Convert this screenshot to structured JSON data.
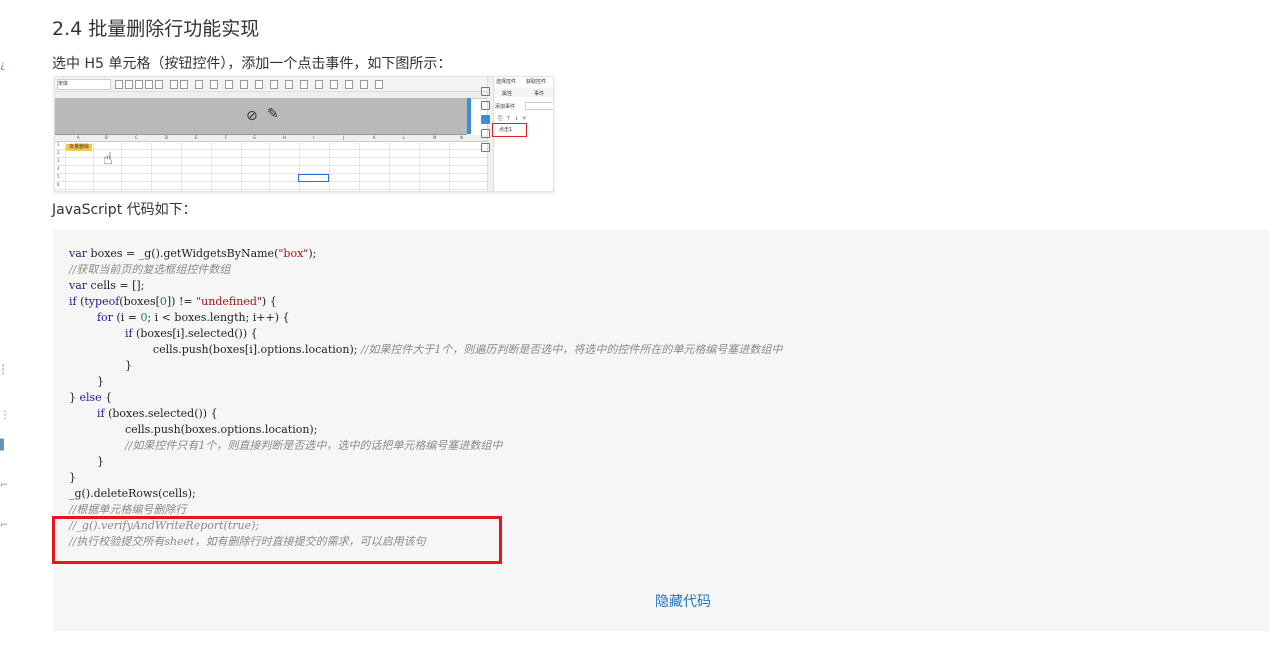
{
  "article": {
    "section_title": "2.4 批量删除行功能实现",
    "intro_text": "选中 H5 单元格（按钮控件），添加一个点击事件，如下图所示：",
    "js_caption": "JavaScript 代码如下："
  },
  "screenshot": {
    "toolbar_font": "宋体",
    "batch_button_label": "批量删除",
    "right_panel": {
      "tab1": "选择控件",
      "tab2": "获取控件",
      "subtab1": "属性",
      "subtab2": "事件",
      "add_event_label": "添加事件",
      "event_item": "点击1"
    },
    "icons": [
      "hidden-eye-icon",
      "pencil-icon",
      "hand-cursor-icon"
    ]
  },
  "code": {
    "lines": [
      "var boxes = _g().getWidgetsByName(\"box\");",
      "//获取当前页的复选框组控件数组",
      "var cells = [];",
      "if (typeof(boxes[0]) != \"undefined\") {",
      "        for (i = 0; i < boxes.length; i++) {",
      "                if (boxes[i].selected()) {",
      "                        cells.push(boxes[i].options.location); //如果控件大于1个，则遍历判断是否选中，将选中的控件所在的单元格编号塞进数组中",
      "                }",
      "        }",
      "} else {",
      "        if (boxes.selected()) {",
      "                cells.push(boxes.options.location);",
      "                //如果控件只有1个，则直接判断是否选中，选中的话把单元格编号塞进数组中",
      "        }",
      "}",
      "_g().deleteRows(cells);",
      "//根据单元格编号删除行",
      "//_g().verifyAndWriteReport(true);",
      "//执行校验提交所有sheet，如有删除行时直接提交的需求，可以启用该句"
    ]
  },
  "actions": {
    "hide_code": "隐藏代码"
  }
}
